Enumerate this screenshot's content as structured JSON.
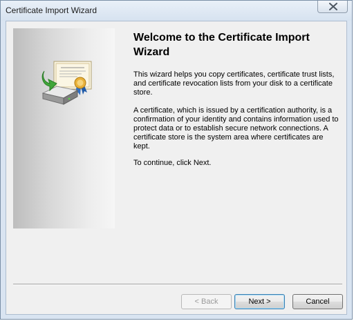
{
  "window": {
    "title": "Certificate Import Wizard"
  },
  "content": {
    "heading": "Welcome to the Certificate Import Wizard",
    "paragraphs": [
      "This wizard helps you copy certificates, certificate trust lists, and certificate revocation lists from your disk to a certificate store.",
      "A certificate, which is issued by a certification authority, is a confirmation of your identity and contains information used to protect data or to establish secure network connections. A certificate store is the system area where certificates are kept.",
      "To continue, click Next."
    ]
  },
  "buttons": {
    "back": "< Back",
    "next": "Next >",
    "cancel": "Cancel"
  },
  "icons": {
    "close": "close-icon",
    "wizard": "certificate-import-icon"
  }
}
